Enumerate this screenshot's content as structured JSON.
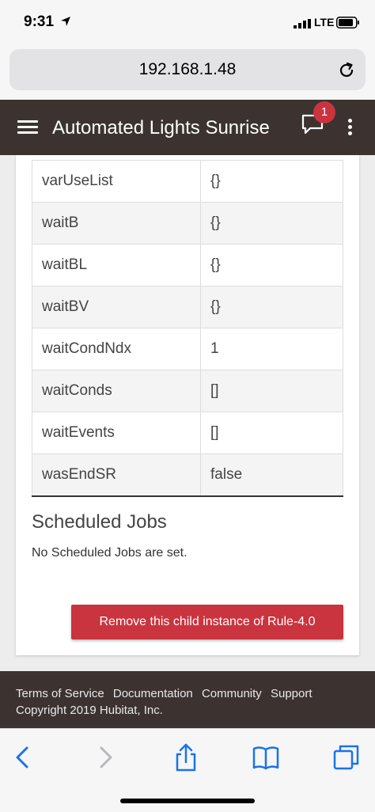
{
  "status_bar": {
    "time": "9:31",
    "network": "LTE"
  },
  "browser": {
    "url": "192.168.1.48"
  },
  "header": {
    "title": "Automated Lights Sunrise",
    "notification_count": "1"
  },
  "variables_table": {
    "rows": [
      {
        "name": "varUseList",
        "value": "{}"
      },
      {
        "name": "waitB",
        "value": "{}"
      },
      {
        "name": "waitBL",
        "value": "{}"
      },
      {
        "name": "waitBV",
        "value": "{}"
      },
      {
        "name": "waitCondNdx",
        "value": "1"
      },
      {
        "name": "waitConds",
        "value": "[]"
      },
      {
        "name": "waitEvents",
        "value": "[]"
      },
      {
        "name": "wasEndSR",
        "value": "false"
      }
    ]
  },
  "scheduled_jobs": {
    "heading": "Scheduled Jobs",
    "message": "No Scheduled Jobs are set."
  },
  "actions": {
    "remove_label": "Remove this child instance of Rule-4.0"
  },
  "footer": {
    "links": [
      "Terms of Service",
      "Documentation",
      "Community",
      "Support"
    ],
    "copyright": "Copyright 2019 Hubitat, Inc."
  },
  "colors": {
    "header_bg": "#3c3330",
    "accent_red": "#c9343f",
    "ios_blue": "#1a73e8"
  }
}
